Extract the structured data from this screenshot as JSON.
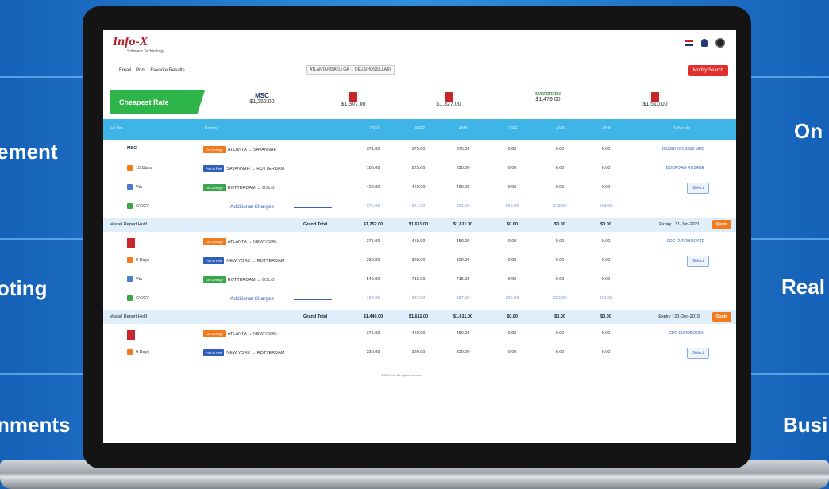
{
  "side_labels": {
    "left": [
      "ement",
      "oting",
      "nments"
    ],
    "right": [
      "On",
      "Real",
      "Busi"
    ]
  },
  "app": {
    "logo": "Info-X",
    "logo_sub": "Software Technology",
    "toolbar": [
      "Email",
      "Print",
      "Favorite Results"
    ],
    "route": "ATLANTA(USATL) GA → DEUS(HOSSILLAR)",
    "modify_label": "Modify Search",
    "cheapest_label": "Cheapest Rate"
  },
  "carriers": [
    {
      "name": "MSC",
      "price": "$1,252.00",
      "logo": "msc-logo"
    },
    {
      "name": "",
      "price": "$1,307.00",
      "logo": "red-box-logo"
    },
    {
      "name": "",
      "price": "$1,327.00",
      "logo": "red-box-logo"
    },
    {
      "name": "EVERGREEN",
      "price": "$1,479.00",
      "logo": "evergreen-logo"
    },
    {
      "name": "",
      "price": "$1,510.00",
      "logo": "red-logo"
    }
  ],
  "results": [
    {
      "legs": [
        {
          "tag": "On Carriage",
          "tag_color": "orange",
          "route": "ATLANTA → SAVANNAH",
          "vals": [
            "371.00",
            "375.00",
            "375.00",
            "0.00",
            "0.00",
            "0.00"
          ],
          "meta": "MSC",
          "right": "HDUSNHIGOSS08 MED",
          "right_type": "link"
        },
        {
          "tag": "Port to Port",
          "tag_color": "blue",
          "route": "SAVANNAH → ROTTERDAM",
          "vals": [
            "185.00",
            "225.00",
            "225.00",
            "0.00",
            "0.00",
            "0.00"
          ],
          "meta": "15 Days",
          "right": "DOCRDAM ROSADE",
          "right_type": "link"
        },
        {
          "tag": "On Carriage",
          "tag_color": "green",
          "route": "ROTTERDAM → OSLO",
          "vals": [
            "420.00",
            "460.00",
            "460.00",
            "0.00",
            "0.00",
            "0.00"
          ],
          "meta": "Via",
          "right": "Select",
          "right_type": "button"
        }
      ],
      "meta_extra": "CY/CY",
      "additional": "Additional Charges",
      "addl_vals": [
        "276.00",
        "961.00",
        "961.00",
        "565.00",
        "278.00",
        "565.00"
      ],
      "grand": {
        "label": "Grand Total",
        "vals": [
          "$1,252.00",
          "$1,611.00",
          "$1,611.00",
          "$0.00",
          "$0.00",
          "$0.00"
        ],
        "left": "Vessel  Report  Hold",
        "expiry": "Expiry : 31-Jan-2021",
        "quote": "Quote"
      }
    },
    {
      "legs": [
        {
          "tag": "On Carriage",
          "tag_color": "orange",
          "route": "ATLANTA → NEW YORK",
          "vals": [
            "375.00",
            "450.00",
            "450.00",
            "0.00",
            "0.00",
            "0.00"
          ],
          "meta": "",
          "right": "CDC EUROBOOKTE",
          "right_type": "link"
        },
        {
          "tag": "Port to Port",
          "tag_color": "blue",
          "route": "NEW YORK → ROTTERDAM",
          "vals": [
            "230.00",
            "320.00",
            "320.00",
            "0.00",
            "0.00",
            "0.00"
          ],
          "meta": "9 Days",
          "right": "Select",
          "right_type": "button"
        },
        {
          "tag": "On Carriage",
          "tag_color": "green",
          "route": "ROTTERDAM → OSLO",
          "vals": [
            "540.00",
            "715.00",
            "715.00",
            "0.00",
            "0.00",
            "0.00"
          ],
          "meta": "Via",
          "right": "",
          "right_type": "none"
        }
      ],
      "meta_extra": "CY/CY",
      "additional": "Additional Charges",
      "addl_vals": [
        "163.00",
        "337.00",
        "337.00",
        "265.00",
        "282.00",
        "221.00"
      ],
      "grand": {
        "label": "Grand Total",
        "vals": [
          "$1,440.00",
          "$1,611.00",
          "$1,611.00",
          "$0.00",
          "$0.00",
          "$0.00"
        ],
        "left": "Vessel  Report  Hold",
        "expiry": "Expiry : 20-Dec-2019",
        "quote": "Quote"
      }
    },
    {
      "legs": [
        {
          "tag": "On Carriage",
          "tag_color": "orange",
          "route": "ATLANTA → NEW YORK",
          "vals": [
            "375.00",
            "450.00",
            "450.00",
            "0.00",
            "0.00",
            "0.00"
          ],
          "meta": "",
          "right": "CDC EUROBOOKN",
          "right_type": "link"
        },
        {
          "tag": "Port to Port",
          "tag_color": "blue",
          "route": "NEW YORK → ROTTERDAM",
          "vals": [
            "230.00",
            "320.00",
            "320.00",
            "0.00",
            "0.00",
            "0.00"
          ],
          "meta": "9 Days",
          "right": "Select",
          "right_type": "button"
        }
      ]
    }
  ],
  "copyright": "© INFO-X. All rights reserved"
}
